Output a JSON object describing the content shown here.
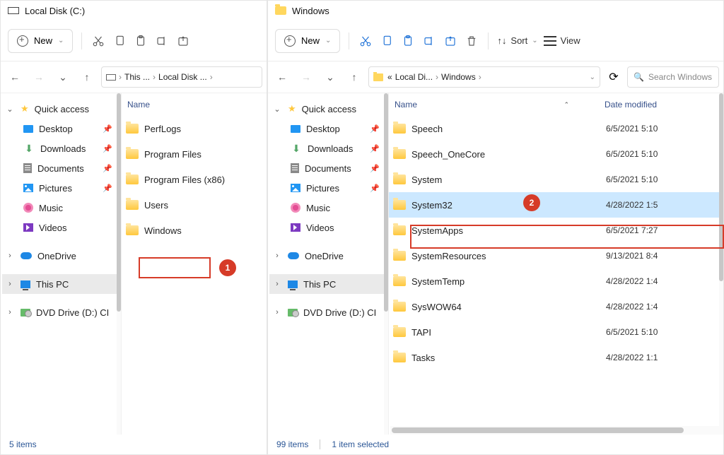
{
  "left": {
    "title": "Local Disk (C:)",
    "new_label": "New",
    "breadcrumb": [
      "This ...",
      "Local Disk ..."
    ],
    "sidebar": {
      "quick_access": "Quick access",
      "items": [
        "Desktop",
        "Downloads",
        "Documents",
        "Pictures",
        "Music",
        "Videos"
      ],
      "onedrive": "OneDrive",
      "thispc": "This PC",
      "dvd": "DVD Drive (D:) CI"
    },
    "columns": {
      "name": "Name"
    },
    "files": [
      {
        "name": "PerfLogs"
      },
      {
        "name": "Program Files"
      },
      {
        "name": "Program Files (x86)"
      },
      {
        "name": "Users"
      },
      {
        "name": "Windows"
      }
    ],
    "status": "5 items"
  },
  "right": {
    "title": "Windows",
    "new_label": "New",
    "sort_label": "Sort",
    "view_label": "View",
    "breadcrumb": [
      "«",
      "Local Di...",
      "Windows"
    ],
    "search_placeholder": "Search Windows",
    "sidebar": {
      "quick_access": "Quick access",
      "items": [
        "Desktop",
        "Downloads",
        "Documents",
        "Pictures",
        "Music",
        "Videos"
      ],
      "onedrive": "OneDrive",
      "thispc": "This PC",
      "dvd": "DVD Drive (D:) CI"
    },
    "columns": {
      "name": "Name",
      "date": "Date modified"
    },
    "files": [
      {
        "name": "Speech",
        "date": "6/5/2021 5:10"
      },
      {
        "name": "Speech_OneCore",
        "date": "6/5/2021 5:10"
      },
      {
        "name": "System",
        "date": "6/5/2021 5:10"
      },
      {
        "name": "System32",
        "date": "4/28/2022 1:5",
        "selected": true
      },
      {
        "name": "SystemApps",
        "date": "6/5/2021 7:27"
      },
      {
        "name": "SystemResources",
        "date": "9/13/2021 8:4"
      },
      {
        "name": "SystemTemp",
        "date": "4/28/2022 1:4"
      },
      {
        "name": "SysWOW64",
        "date": "4/28/2022 1:4"
      },
      {
        "name": "TAPI",
        "date": "6/5/2021 5:10"
      },
      {
        "name": "Tasks",
        "date": "4/28/2022 1:1"
      }
    ],
    "status_count": "99 items",
    "status_sel": "1 item selected"
  },
  "annotations": {
    "a1": "1",
    "a2": "2"
  }
}
